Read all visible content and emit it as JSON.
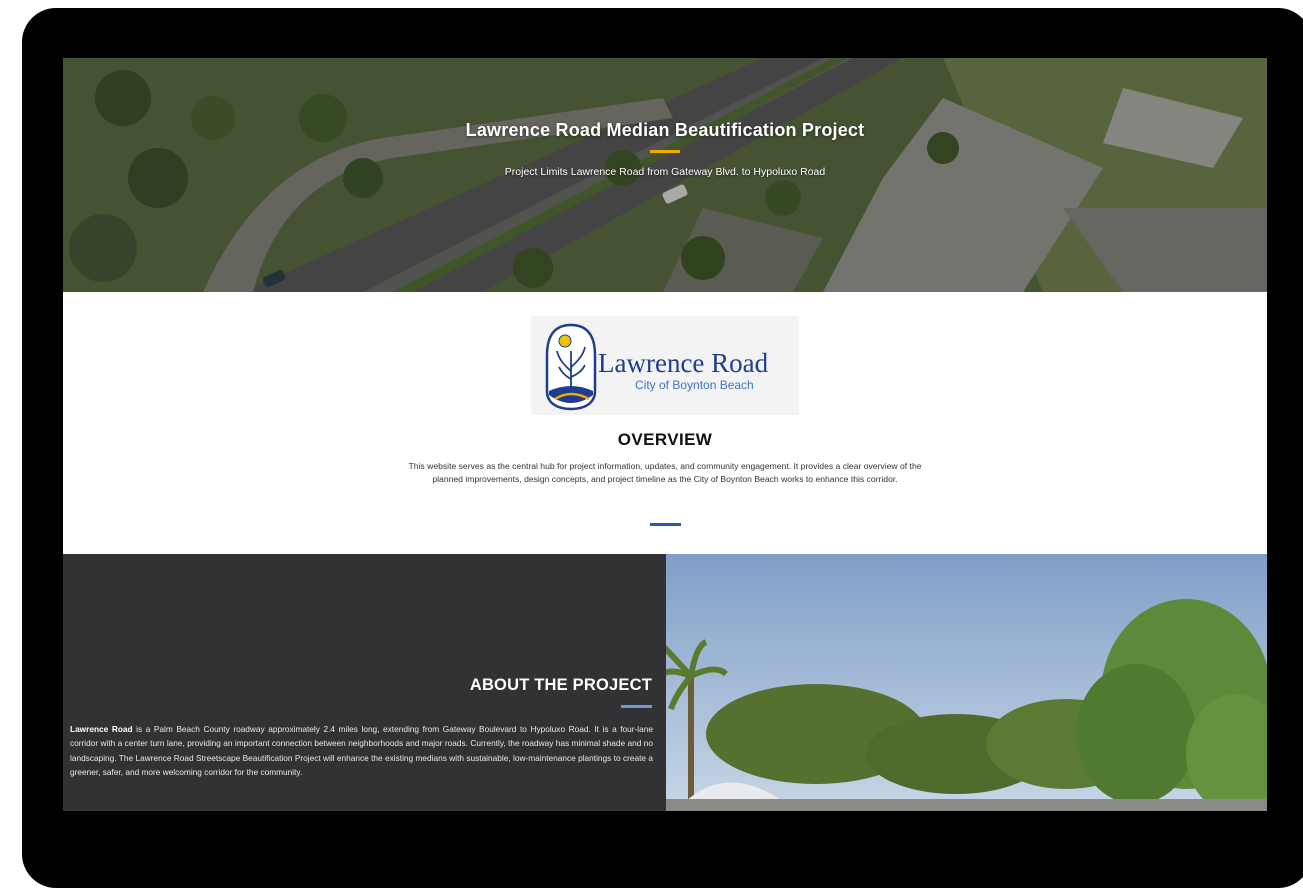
{
  "hero": {
    "title": "Lawrence Road Median Beautification Project",
    "subtitle": "Project Limits Lawrence Road from Gateway Blvd. to Hypoluxo Road"
  },
  "logo": {
    "name": "Lawrence Road",
    "subname": "City of Boynton Beach"
  },
  "overview": {
    "heading": "OVERVIEW",
    "body": "This website serves as the central hub for project information, updates, and community engagement. It provides a clear overview of the planned improvements, design concepts, and project timeline as the City of Boynton Beach works to enhance this corridor."
  },
  "about": {
    "heading": "ABOUT THE PROJECT",
    "lead": "Lawrence Road",
    "body": " is a Palm Beach County roadway approximately 2.4 miles long, extending from Gateway Boulevard to Hypoluxo Road. It is a four-lane corridor with a center turn lane, providing an important connection between neighborhoods and major roads. Currently, the roadway has minimal shade and no landscaping. The Lawrence Road Streetscape Beautification Project will enhance the existing medians with sustainable, low-maintenance plantings to create a greener, safer, and more welcoming corridor for the community."
  },
  "colors": {
    "hero_accent": "#f2a900",
    "overview_accent": "#2d5aa6",
    "about_accent": "#6a9ad6",
    "about_background": "#323235",
    "logo_blue": "#1e3d8f"
  }
}
